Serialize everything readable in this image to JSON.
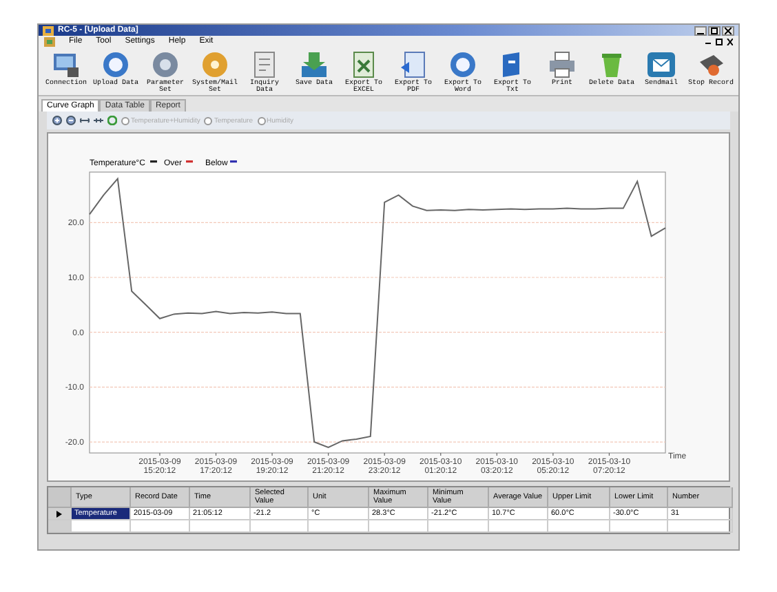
{
  "window": {
    "title": "RC-5 - [Upload Data]"
  },
  "menu": [
    "File",
    "Tool",
    "Settings",
    "Help",
    "Exit"
  ],
  "toolbar": [
    {
      "label": "Connection"
    },
    {
      "label": "Upload Data"
    },
    {
      "label": "Parameter Set"
    },
    {
      "label": "System/Mail Set"
    },
    {
      "label": "Inquiry Data"
    },
    {
      "label": "Save Data"
    },
    {
      "label": "Export To EXCEL"
    },
    {
      "label": "Export To PDF"
    },
    {
      "label": "Export To Word"
    },
    {
      "label": "Export To Txt"
    },
    {
      "label": "Print"
    },
    {
      "label": "Delete Data"
    },
    {
      "label": "Sendmail"
    },
    {
      "label": "Stop Record"
    }
  ],
  "tabs": [
    {
      "label": "Curve Graph",
      "selected": true
    },
    {
      "label": "Data Table",
      "selected": false
    },
    {
      "label": "Report",
      "selected": false
    }
  ],
  "chart_options": [
    {
      "label": "Temperature+Humidity",
      "selected": false,
      "disabled": true
    },
    {
      "label": "Temperature",
      "selected": false,
      "disabled": true
    },
    {
      "label": "Humidity",
      "selected": false,
      "disabled": true
    }
  ],
  "legend": {
    "items": [
      {
        "label": "Over",
        "color": "#d03030"
      },
      {
        "label": "Below",
        "color": "#3030b0"
      }
    ]
  },
  "chart_data": {
    "type": "line",
    "xlabel": "Time",
    "ylim": [
      -22,
      29.2
    ],
    "yticks": [
      {
        "value": 20,
        "label": "20.0"
      },
      {
        "value": 10,
        "label": "10.0"
      },
      {
        "value": 0,
        "label": "0.0"
      },
      {
        "value": -10,
        "label": "-10.0"
      },
      {
        "value": -20,
        "label": "-20.0"
      }
    ],
    "categories": [
      null,
      null,
      null,
      null,
      null,
      "2015-03-09 15:20:12",
      null,
      null,
      null,
      "2015-03-09 17:20:12",
      null,
      null,
      null,
      "2015-03-09 19:20:12",
      null,
      null,
      null,
      "2015-03-09 21:20:12",
      null,
      null,
      null,
      "2015-03-09 23:20:12",
      null,
      null,
      null,
      "2015-03-10 01:20:12",
      null,
      null,
      null,
      "2015-03-10 03:20:12",
      null,
      null,
      null,
      "2015-03-10 05:20:12",
      null,
      null,
      null,
      "2015-03-10 07:20:12",
      null,
      null,
      null,
      null
    ],
    "series": [
      {
        "name": "Temperature°C",
        "color": "#666666",
        "values": [
          21.5,
          25,
          28,
          7.5,
          5,
          2.5,
          3.3,
          3.5,
          3.4,
          3.8,
          3.4,
          3.6,
          3.5,
          3.7,
          3.4,
          3.4,
          -20,
          -21,
          -19.8,
          -19.5,
          -19,
          23.7,
          25,
          23,
          22.2,
          22.3,
          22.2,
          22.4,
          22.3,
          22.4,
          22.5,
          22.4,
          22.5,
          22.5,
          22.6,
          22.5,
          22.5,
          22.6,
          22.6,
          27.5,
          17.5,
          19
        ]
      }
    ],
    "grid": true
  },
  "table": {
    "columns": [
      "Type",
      "Record Date",
      "Time",
      "Selected Value",
      "Unit",
      "Maximum Value",
      "Minimum Value",
      "Average Value",
      "Upper Limit",
      "Lower Limit",
      "Number"
    ],
    "rows": [
      {
        "selected": true,
        "cells": [
          "Temperature",
          "2015-03-09",
          "21:05:12",
          "-21.2",
          "°C",
          "28.3°C",
          "-21.2°C",
          "10.7°C",
          "60.0°C",
          "-30.0°C",
          "31"
        ]
      },
      {
        "selected": false,
        "cells": []
      }
    ]
  }
}
